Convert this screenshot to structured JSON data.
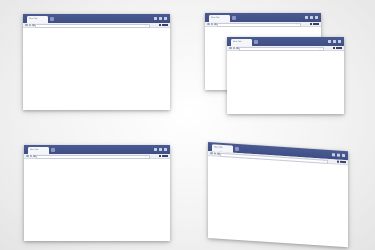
{
  "windows": [
    {
      "id": "top-left",
      "tab_title": "New Tab",
      "address_text": ""
    },
    {
      "id": "back-right",
      "tab_title": "New Tab",
      "address_text": ""
    },
    {
      "id": "front-right",
      "tab_title": "New Tab",
      "address_text": ""
    },
    {
      "id": "bottom-left",
      "tab_title": "New Tab",
      "address_text": ""
    },
    {
      "id": "bottom-right-tilted",
      "tab_title": "New Tab",
      "address_text": ""
    }
  ],
  "icons": {
    "nav": [
      "back-icon",
      "forward-icon",
      "reload-icon"
    ],
    "toolbar": [
      "bookmark-star-icon",
      "extension-icon",
      "menu-icon"
    ],
    "window_controls": [
      "minimize-icon",
      "maximize-icon",
      "close-icon"
    ]
  },
  "colors": {
    "chrome_bar": "#44548b",
    "toolbar": "#eef0f5",
    "page": "#ffffff",
    "background": "#f3f3f3"
  }
}
